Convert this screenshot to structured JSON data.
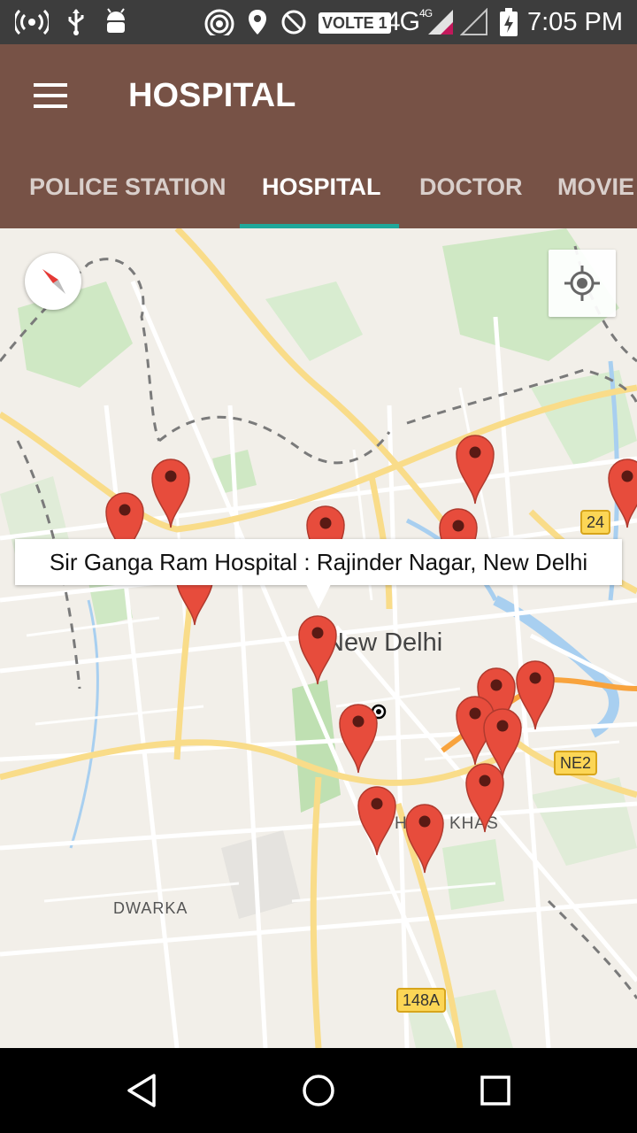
{
  "status_bar": {
    "time": "7:05 PM",
    "volte_label": "VOLTE 1",
    "network_label": "4G",
    "network_small": "4G",
    "icons": [
      "hotspot-icon",
      "usb-icon",
      "android-debug-icon",
      "wireless-icon",
      "location-icon",
      "do-not-disturb-icon",
      "signal-icon",
      "battery-icon"
    ]
  },
  "app_bar": {
    "title": "HOSPITAL",
    "menu_icon": "menu-icon"
  },
  "tabs": [
    {
      "label": "POLICE STATION",
      "active": false
    },
    {
      "label": "HOSPITAL",
      "active": true
    },
    {
      "label": "DOCTOR",
      "active": false
    },
    {
      "label": "MOVIE",
      "active": false
    }
  ],
  "map": {
    "info_window": "Sir Ganga Ram Hospital : Rajinder Nagar, New Delhi",
    "city_label": "New Delhi",
    "area_labels": [
      "DWARKA",
      "HAUZ KHAS"
    ],
    "road_shields": [
      "24",
      "NE2",
      "148A"
    ],
    "compass_icon": "compass-icon",
    "locate_icon": "my-location-icon",
    "marker_color": "#e74c3c"
  },
  "nav_bar": {
    "buttons": [
      "back-icon",
      "home-icon",
      "recents-icon"
    ]
  }
}
